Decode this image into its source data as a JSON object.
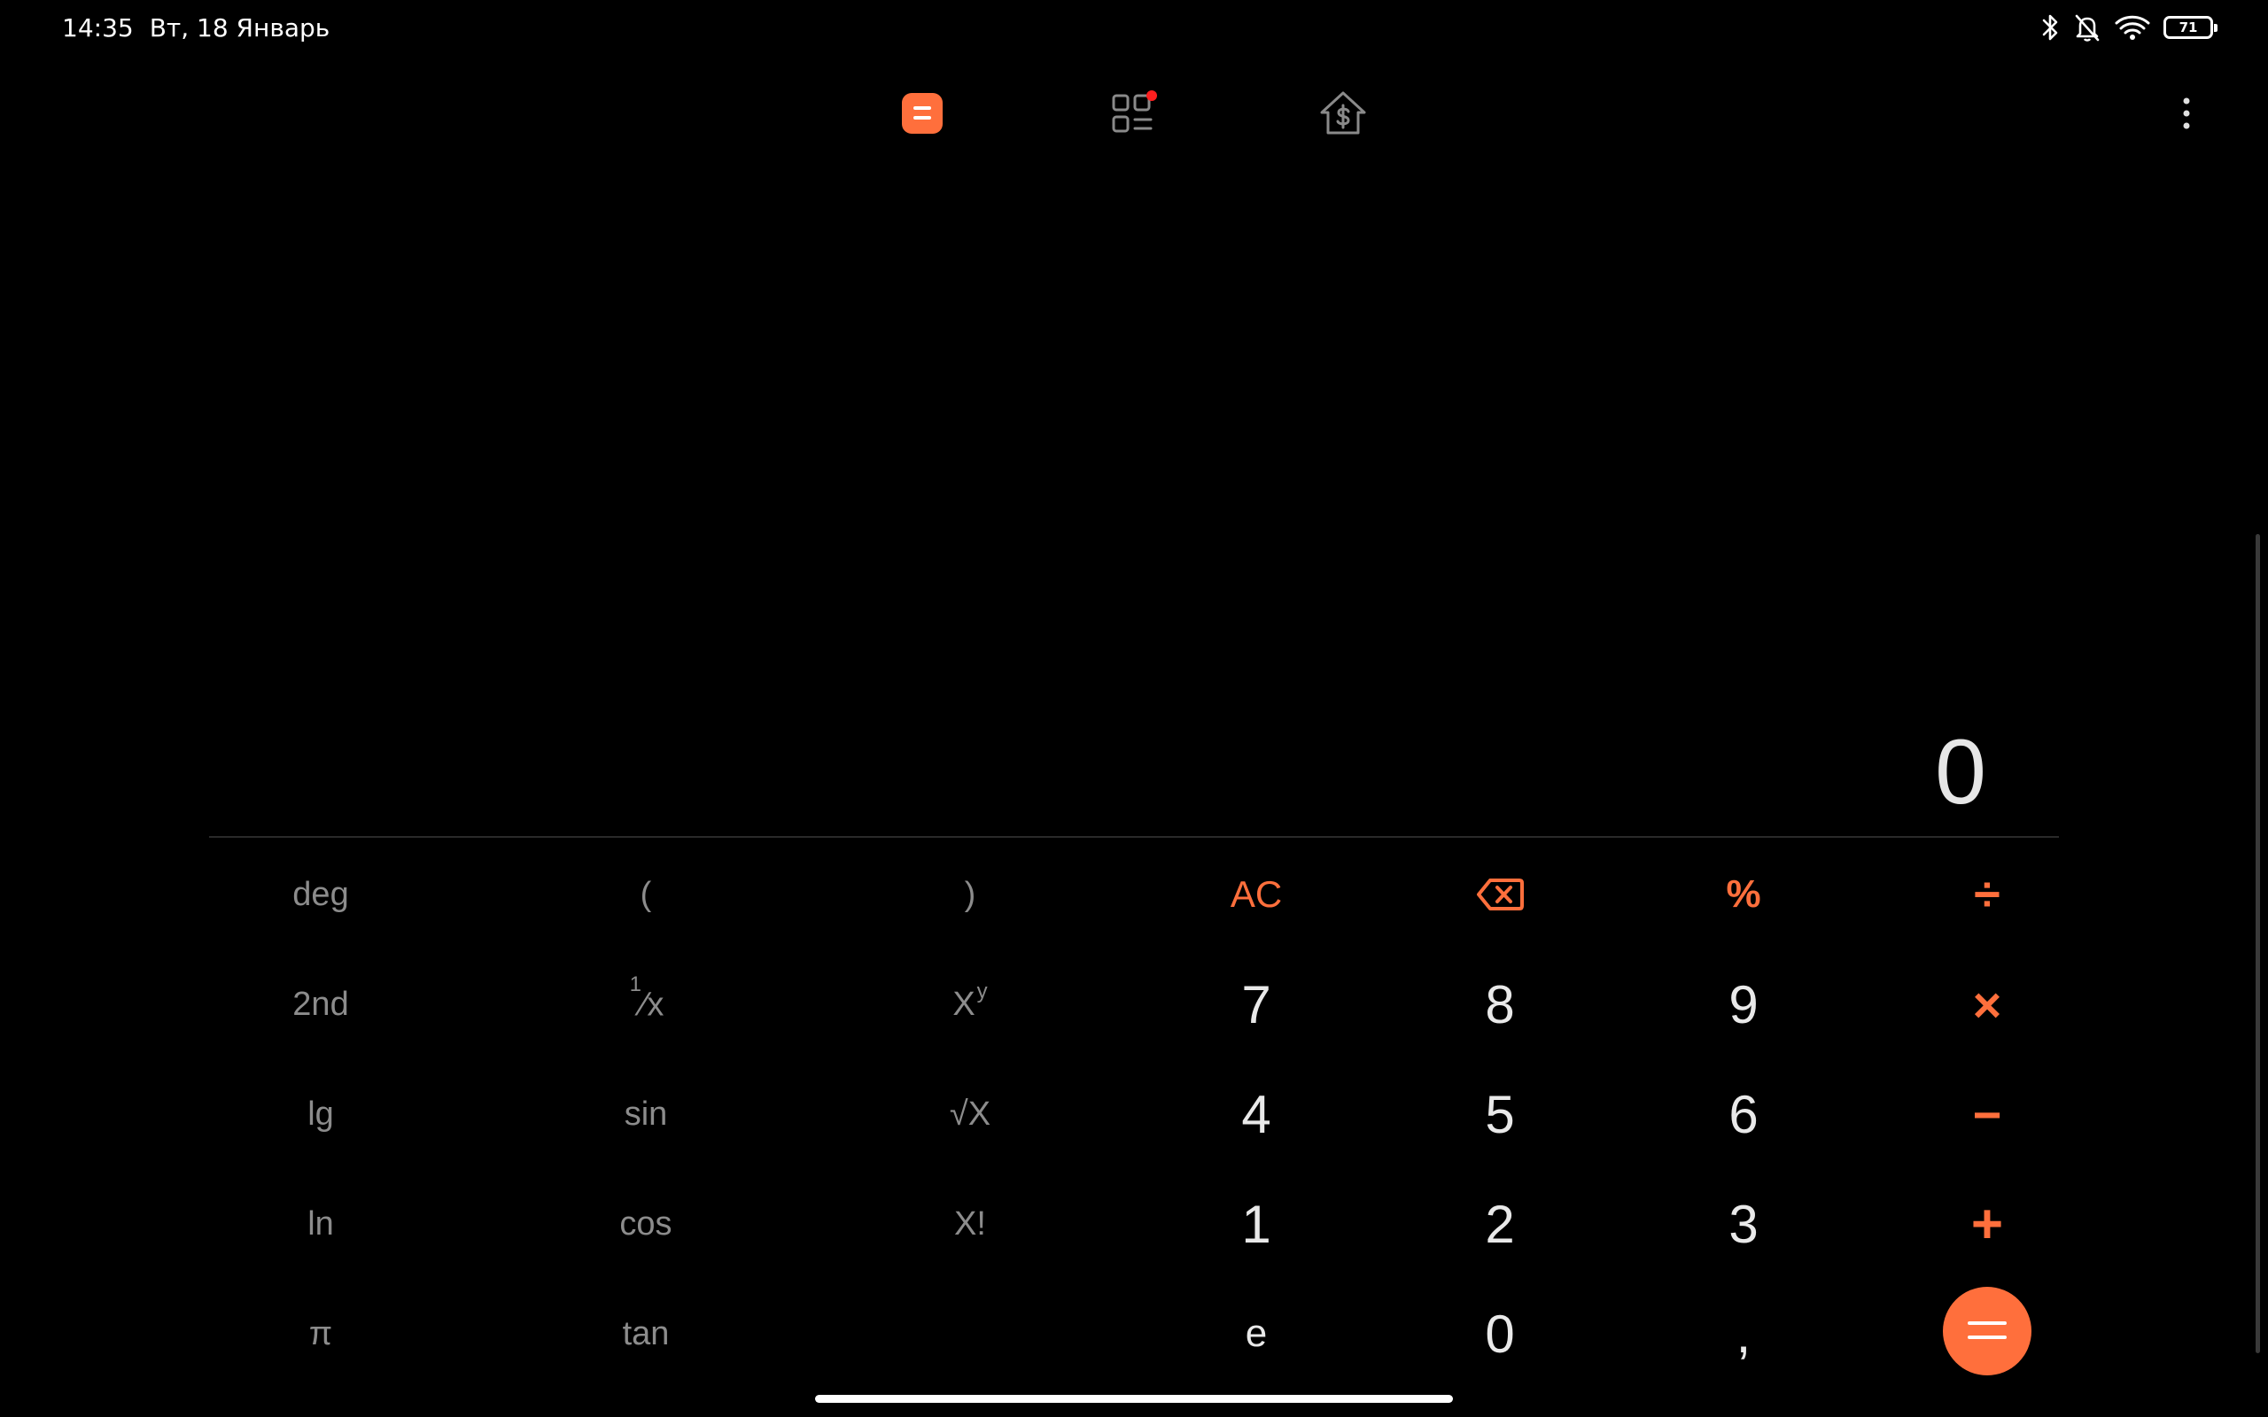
{
  "status_bar": {
    "time": "14:35",
    "date": "Вт, 18 Январь",
    "battery_level": "71",
    "icons": [
      "bluetooth-icon",
      "bell-muted-icon",
      "wifi-icon",
      "battery-icon"
    ]
  },
  "tabs": [
    {
      "name": "calculator",
      "icon": "calculator-icon",
      "active": true
    },
    {
      "name": "converters",
      "icon": "grid-list-icon",
      "active": false,
      "badge": true
    },
    {
      "name": "mortgage",
      "icon": "house-dollar-icon",
      "active": false
    }
  ],
  "display": {
    "value": "0"
  },
  "keys": {
    "deg": "deg",
    "open_paren": "(",
    "close_paren": ")",
    "ac": "AC",
    "percent": "%",
    "divide": "÷",
    "second": "2nd",
    "reciprocal_num": "1",
    "reciprocal_den": "x",
    "power_base": "X",
    "power_exp": "y",
    "seven": "7",
    "eight": "8",
    "nine": "9",
    "multiply": "×",
    "lg": "lg",
    "sin": "sin",
    "sqrt": "√X",
    "four": "4",
    "five": "5",
    "six": "6",
    "minus": "−",
    "ln": "ln",
    "cos": "cos",
    "factorial": "X!",
    "one": "1",
    "two": "2",
    "three": "3",
    "plus": "+",
    "pi": "π",
    "tan": "tan",
    "e": "e",
    "zero": "0",
    "comma": ",",
    "equals": "="
  },
  "colors": {
    "accent": "#ff6f3c",
    "background": "#000000",
    "number_text": "#e9e9e9",
    "scientific_text": "#8c8c8c",
    "badge": "#ff1f1f"
  }
}
